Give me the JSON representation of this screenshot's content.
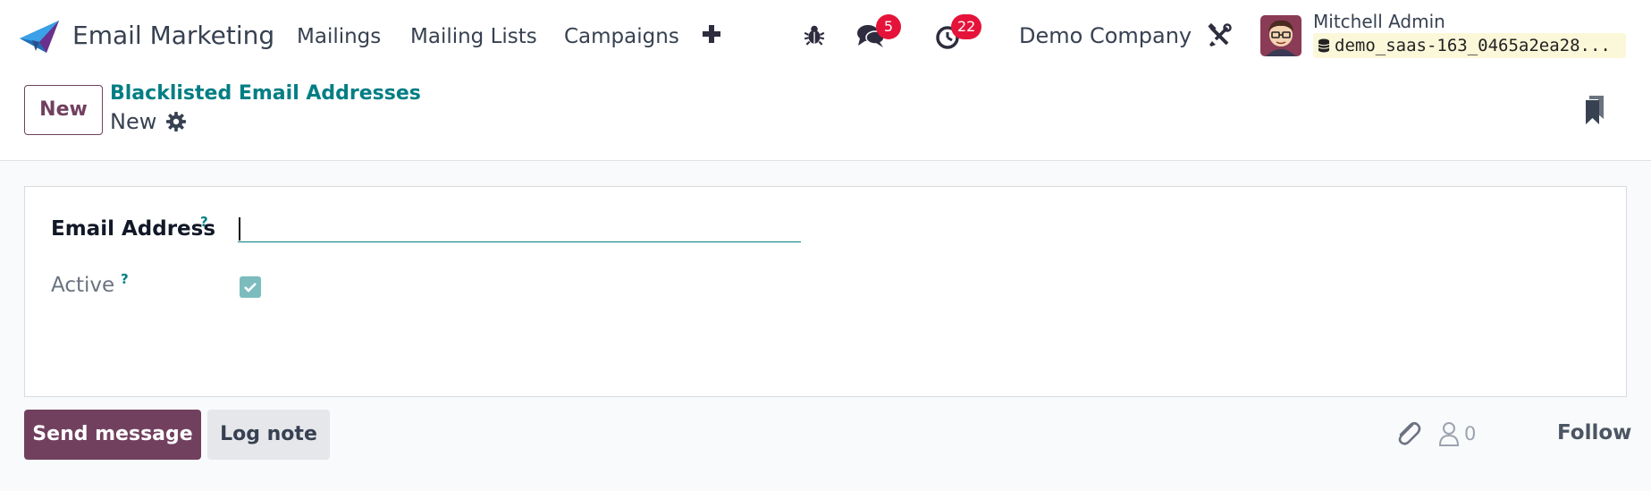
{
  "app": {
    "name": "Email Marketing",
    "brand_color": "#71405f",
    "accent_color": "#017e84"
  },
  "menu": [
    {
      "label": "Mailings"
    },
    {
      "label": "Mailing Lists"
    },
    {
      "label": "Campaigns"
    }
  ],
  "systray": {
    "messages_count": "5",
    "activities_count": "22",
    "company": "Demo Company",
    "user_name": "Mitchell Admin",
    "database": "demo_saas-163_0465a2ea28..."
  },
  "control_panel": {
    "new_label": "New",
    "breadcrumb": "Blacklisted Email Addresses",
    "record_title": "New"
  },
  "form": {
    "email_label": "Email Address",
    "email_value": "",
    "active_label": "Active",
    "active_checked": true,
    "help_mark": "?"
  },
  "chatter": {
    "send_label": "Send message",
    "log_label": "Log note",
    "followers_count": "0",
    "follow_label": "Follow"
  }
}
